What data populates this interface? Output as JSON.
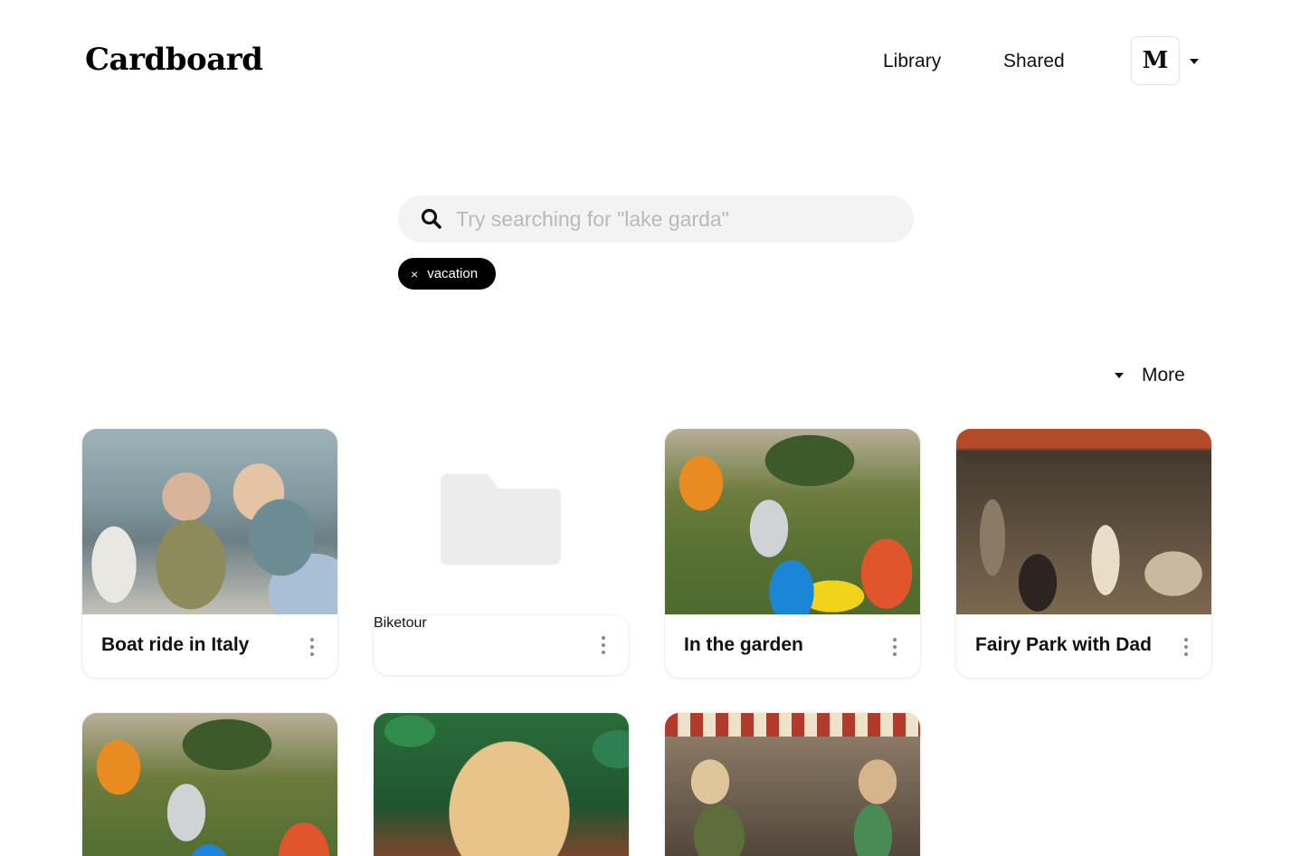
{
  "header": {
    "logo": "Cardboard",
    "nav": {
      "library": "Library",
      "shared": "Shared"
    },
    "avatar_initial": "M",
    "avatar_menu_icon": "caret-down-icon"
  },
  "search": {
    "placeholder": "Try searching for \"lake garda\"",
    "value": "",
    "icon": "search-icon"
  },
  "filters": [
    {
      "label": "vacation",
      "remove_icon": "×"
    }
  ],
  "more": {
    "label": "More",
    "icon": "caret-down-icon"
  },
  "cards": [
    {
      "title": "Boat ride in Italy",
      "kind": "video"
    },
    {
      "title": "Biketour",
      "kind": "folder"
    },
    {
      "title": "In the garden",
      "kind": "video"
    },
    {
      "title": "Fairy Park with Dad",
      "kind": "video"
    },
    {
      "title": "",
      "kind": "video"
    },
    {
      "title": "",
      "kind": "video"
    },
    {
      "title": "",
      "kind": "video"
    }
  ],
  "colors": {
    "background": "#ffffff",
    "chip_background": "#000000",
    "search_background": "#f3f3f3",
    "placeholder_text": "#b9b9b9",
    "folder_icon": "#ececec"
  }
}
